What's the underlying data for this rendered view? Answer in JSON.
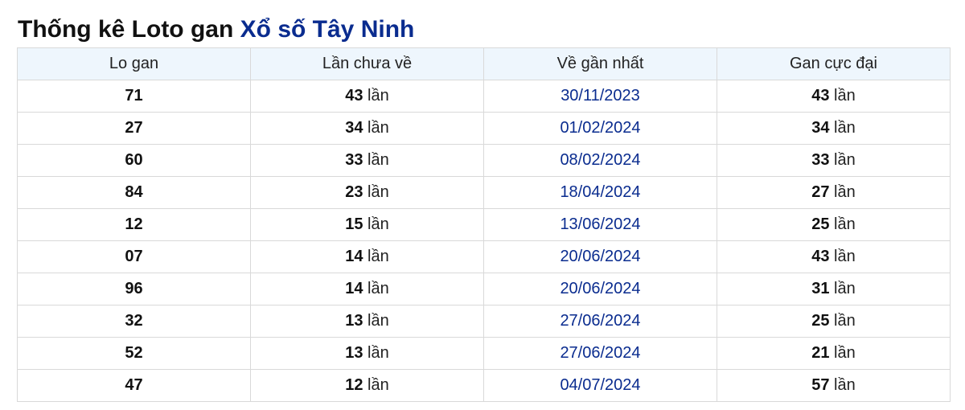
{
  "title": {
    "prefix": "Thống kê Loto gan",
    "link": "Xổ số Tây Ninh"
  },
  "colors": {
    "header_bg": "#eef6fd",
    "link": "#0a2c8f",
    "border": "#d9d9d9"
  },
  "table": {
    "headers": [
      "Lo gan",
      "Lần chưa về",
      "Về gần nhất",
      "Gan cực đại"
    ],
    "unit": "lần",
    "rows": [
      {
        "lo": "71",
        "chua_ve": "43",
        "gan_nhat": "30/11/2023",
        "cuc_dai": "43"
      },
      {
        "lo": "27",
        "chua_ve": "34",
        "gan_nhat": "01/02/2024",
        "cuc_dai": "34"
      },
      {
        "lo": "60",
        "chua_ve": "33",
        "gan_nhat": "08/02/2024",
        "cuc_dai": "33"
      },
      {
        "lo": "84",
        "chua_ve": "23",
        "gan_nhat": "18/04/2024",
        "cuc_dai": "27"
      },
      {
        "lo": "12",
        "chua_ve": "15",
        "gan_nhat": "13/06/2024",
        "cuc_dai": "25"
      },
      {
        "lo": "07",
        "chua_ve": "14",
        "gan_nhat": "20/06/2024",
        "cuc_dai": "43"
      },
      {
        "lo": "96",
        "chua_ve": "14",
        "gan_nhat": "20/06/2024",
        "cuc_dai": "31"
      },
      {
        "lo": "32",
        "chua_ve": "13",
        "gan_nhat": "27/06/2024",
        "cuc_dai": "25"
      },
      {
        "lo": "52",
        "chua_ve": "13",
        "gan_nhat": "27/06/2024",
        "cuc_dai": "21"
      },
      {
        "lo": "47",
        "chua_ve": "12",
        "gan_nhat": "04/07/2024",
        "cuc_dai": "57"
      }
    ]
  }
}
